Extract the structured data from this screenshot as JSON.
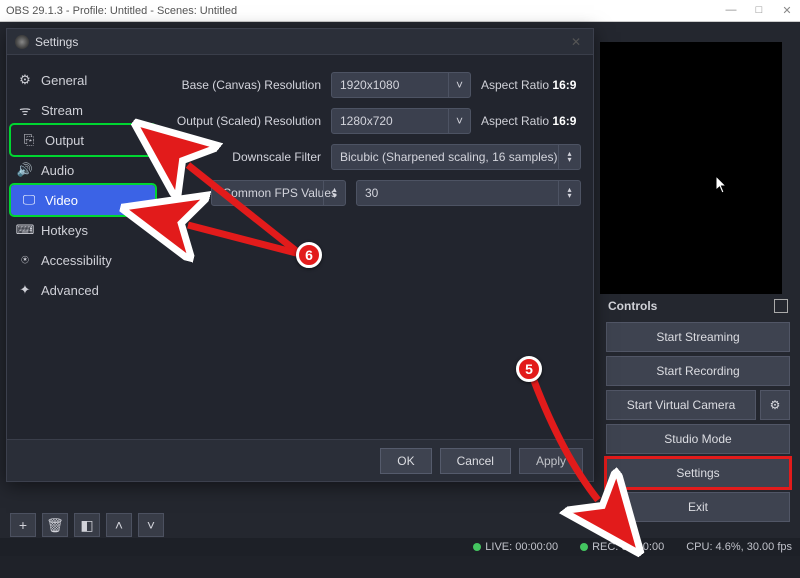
{
  "window": {
    "title": "OBS 29.1.3 - Profile: Untitled - Scenes: Untitled"
  },
  "dialog": {
    "title": "Settings",
    "sidebar": {
      "items": [
        {
          "label": "General"
        },
        {
          "label": "Stream"
        },
        {
          "label": "Output"
        },
        {
          "label": "Audio"
        },
        {
          "label": "Video"
        },
        {
          "label": "Hotkeys"
        },
        {
          "label": "Accessibility"
        },
        {
          "label": "Advanced"
        }
      ]
    },
    "video": {
      "base_label": "Base (Canvas) Resolution",
      "base_value": "1920x1080",
      "base_ar_label": "Aspect Ratio",
      "base_ar_value": "16:9",
      "output_label": "Output (Scaled) Resolution",
      "output_value": "1280x720",
      "output_ar_label": "Aspect Ratio",
      "output_ar_value": "16:9",
      "filter_label": "Downscale Filter",
      "filter_value": "Bicubic (Sharpened scaling, 16 samples)",
      "fps_type_label": "Common FPS Values",
      "fps_value": "30"
    },
    "footer": {
      "ok": "OK",
      "cancel": "Cancel",
      "apply": "Apply"
    }
  },
  "controls": {
    "header": "Controls",
    "start_streaming": "Start Streaming",
    "start_recording": "Start Recording",
    "start_virtual_camera": "Start Virtual Camera",
    "studio_mode": "Studio Mode",
    "settings": "Settings",
    "exit": "Exit"
  },
  "status": {
    "live": "LIVE: 00:00:00",
    "rec": "REC: 00:00:00",
    "cpu": "CPU: 4.6%, 30.00 fps"
  },
  "annotations": {
    "badge5": "5",
    "badge6": "6"
  }
}
